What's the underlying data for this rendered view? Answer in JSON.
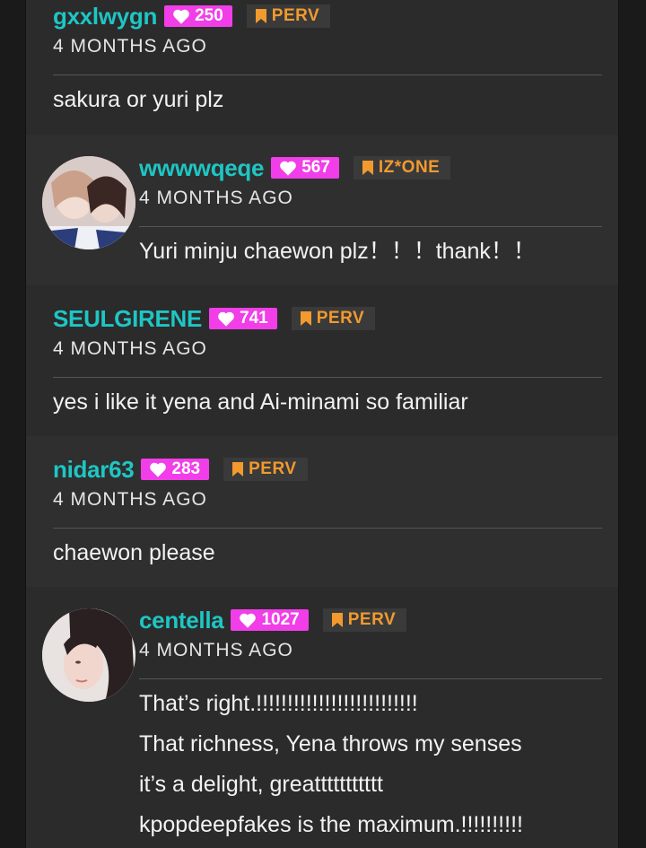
{
  "comments": [
    {
      "username": "gxxlwygn",
      "likes": "250",
      "tag": "PERV",
      "time": "4 MONTHS AGO",
      "text": [
        "sakura or yuri plz"
      ]
    },
    {
      "username": "wwwwqeqe",
      "likes": "567",
      "tag": "IZ*ONE",
      "time": "4 MONTHS AGO",
      "text": [
        "Yuri minju chaewon plz！！！thank！！"
      ]
    },
    {
      "username": "SEULGIRENE",
      "likes": "741",
      "tag": "PERV",
      "time": "4 MONTHS AGO",
      "text": [
        "yes i like it yena and Ai-minami so familiar"
      ]
    },
    {
      "username": "nidar63",
      "likes": "283",
      "tag": "PERV",
      "time": "4 MONTHS AGO",
      "text": [
        "chaewon please"
      ]
    },
    {
      "username": "centella",
      "likes": "1027",
      "tag": "PERV",
      "time": "4 MONTHS AGO",
      "text": [
        "That’s right.!!!!!!!!!!!!!!!!!!!!!!!!!!",
        "That richness, Yena throws my senses",
        "it’s a delight, greattttttttttt",
        "kpopdeepfakes is the maximum.!!!!!!!!!!"
      ]
    }
  ],
  "colors": {
    "username": "#1ec6c4",
    "likes_badge": "#f13ee8",
    "tag_text": "#f29a2e",
    "background": "#2b2b2b"
  },
  "icons": {
    "likes": "heart-icon",
    "tag": "bookmark-icon"
  }
}
